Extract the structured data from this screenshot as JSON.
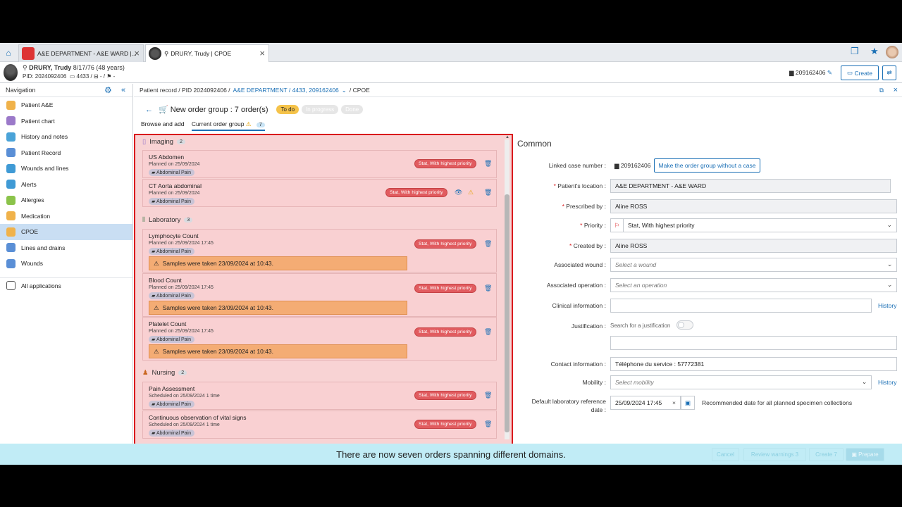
{
  "tabs": [
    {
      "label": "A&E DEPARTMENT - A&E WARD |..."
    },
    {
      "label": "DRURY, Trudy | CPOE"
    }
  ],
  "patient": {
    "name": "DRURY, Trudy",
    "dob": "8/17/76 (48 years)",
    "pid": "PID: 2024092406",
    "bed": "4433",
    "extra": "/ ⊟ - / ⚑ -",
    "case": "209162406",
    "create": "Create"
  },
  "nav": {
    "title": "Navigation",
    "items": [
      {
        "label": "Patient A&E",
        "color": "#f0b24a"
      },
      {
        "label": "Patient chart",
        "color": "#9b79c9"
      },
      {
        "label": "History and notes",
        "color": "#4aa3d8"
      },
      {
        "label": "Patient Record",
        "color": "#5a8fd6"
      },
      {
        "label": "Wounds and lines",
        "color": "#3f9ad5"
      },
      {
        "label": "Alerts",
        "color": "#3f9ad5"
      },
      {
        "label": "Allergies",
        "color": "#8bc34a"
      },
      {
        "label": "Medication",
        "color": "#f0b24a"
      },
      {
        "label": "CPOE",
        "color": "#f0b24a"
      },
      {
        "label": "Lines and drains",
        "color": "#5a8fd6"
      },
      {
        "label": "Wounds",
        "color": "#5a8fd6"
      }
    ],
    "all": "All applications"
  },
  "crumb": {
    "a": "Patient record / PID 2024092406 /",
    "b": "A&E DEPARTMENT / 4433, 209162406",
    "c": "/ CPOE"
  },
  "order": {
    "title": "New order group : 7 order(s)",
    "steps": [
      "To do",
      "In progress",
      "Done"
    ],
    "subtab1": "Browse and add",
    "subtab2": "Current order group",
    "count": "7"
  },
  "sections": [
    {
      "name": "Imaging",
      "count": "2"
    },
    {
      "name": "Laboratory",
      "count": "3"
    },
    {
      "name": "Nursing",
      "count": "2"
    }
  ],
  "cards": [
    {
      "title": "US Abdomen",
      "planned": "Planned on 25/09/2024",
      "tag": "Abdominal Pain",
      "priority": "Stat, With highest priority"
    },
    {
      "title": "CT Aorta abdominal",
      "planned": "Planned on 25/09/2024",
      "tag": "Abdominal Pain",
      "priority": "Stat, With highest priority"
    },
    {
      "title": "Lymphocyte Count",
      "planned": "Planned on 25/09/2024 17:45",
      "tag": "Abdominal Pain",
      "priority": "Stat, With highest priority",
      "sample": "Samples were taken 23/09/2024 at 10:43."
    },
    {
      "title": "Blood Count",
      "planned": "Planned on 25/09/2024 17:45",
      "tag": "Abdominal Pain",
      "priority": "Stat, With highest priority",
      "sample": "Samples were taken 23/09/2024 at 10:43."
    },
    {
      "title": "Platelet Count",
      "planned": "Planned on 25/09/2024 17:45",
      "tag": "Abdominal Pain",
      "priority": "Stat, With highest priority",
      "sample": "Samples were taken 23/09/2024 at 10:43."
    },
    {
      "title": "Pain Assessment",
      "planned": "Scheduled on 25/09/2024 1 time",
      "tag": "Abdominal Pain",
      "priority": "Stat, With highest priority"
    },
    {
      "title": "Continuous observation of vital signs",
      "planned": "Scheduled on 25/09/2024 1 time",
      "tag": "Abdominal Pain",
      "priority": "Stat, With highest priority"
    }
  ],
  "form": {
    "heading": "Common",
    "linked_label": "Linked case number :",
    "linked_value": "209162406",
    "linked_btn": "Make the order group without a case",
    "location_label": "Patient's location :",
    "location_value": "A&E DEPARTMENT - A&E WARD",
    "prescribed_label": "Prescribed by :",
    "prescribed_value": "Aline ROSS",
    "priority_label": "Priority :",
    "priority_value": "Stat, With highest priority",
    "created_label": "Created by :",
    "created_value": "Aline ROSS",
    "wound_label": "Associated wound :",
    "wound_ph": "Select a wound",
    "operation_label": "Associated operation :",
    "operation_ph": "Select an operation",
    "clinical_label": "Clinical information :",
    "history": "History",
    "justif_label": "Justification :",
    "justif_search": "Search for a justification",
    "contact_label": "Contact information :",
    "contact_value": "Téléphone du service : 57772381",
    "mobility_label": "Mobility :",
    "mobility_ph": "Select mobility",
    "deflab_label1": "Default laboratory reference",
    "deflab_label2": "date :",
    "deflab_value": "25/09/2024 17:45",
    "deflab_note": "Recommended date for all planned specimen collections"
  },
  "footer": {
    "caption": "There are now seven orders spanning different domains.",
    "cancel": "Cancel",
    "review": "Review warnings",
    "review_count": "3",
    "create": "Create",
    "create_count": "7",
    "prepare": "Prepare"
  }
}
